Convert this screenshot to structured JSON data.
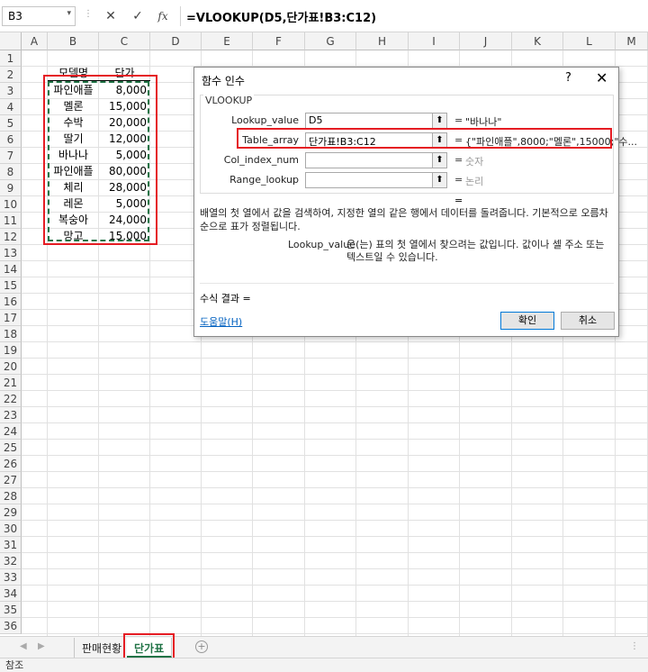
{
  "formula_bar": {
    "name_box": "B3",
    "cancel_icon": "✕",
    "enter_icon": "✓",
    "fx_label": "fx",
    "formula": "=VLOOKUP(D5,단가표!B3:C12)"
  },
  "columns": [
    "A",
    "B",
    "C",
    "D",
    "E",
    "F",
    "G",
    "H",
    "I",
    "J",
    "K",
    "L",
    "M"
  ],
  "rows": [
    "1",
    "2",
    "3",
    "4",
    "5",
    "6",
    "7",
    "8",
    "9",
    "10",
    "11",
    "12",
    "13",
    "14",
    "15",
    "16",
    "17",
    "18",
    "19",
    "20",
    "21",
    "22",
    "23",
    "24",
    "25",
    "26",
    "27",
    "28",
    "29",
    "30",
    "31",
    "32",
    "33",
    "34",
    "35",
    "36"
  ],
  "table": {
    "header_name": "모델명",
    "header_price": "단가",
    "items": [
      {
        "name": "파인애플",
        "price": "8,000"
      },
      {
        "name": "멜론",
        "price": "15,000"
      },
      {
        "name": "수박",
        "price": "20,000"
      },
      {
        "name": "딸기",
        "price": "12,000"
      },
      {
        "name": "바나나",
        "price": "5,000"
      },
      {
        "name": "파인애플",
        "price": "80,000"
      },
      {
        "name": "체리",
        "price": "28,000"
      },
      {
        "name": "레몬",
        "price": "5,000"
      },
      {
        "name": "복숭아",
        "price": "24,000"
      },
      {
        "name": "망고",
        "price": "15,000"
      }
    ]
  },
  "sheet_tabs": [
    {
      "label": "판매현황",
      "active": false
    },
    {
      "label": "단가표",
      "active": true
    }
  ],
  "status": "참조",
  "dialog": {
    "title": "함수 인수",
    "help_glyph": "?",
    "close_glyph": "✕",
    "function_name": "VLOOKUP",
    "args": [
      {
        "label": "Lookup_value",
        "value": "D5",
        "result": "\"바나나\"",
        "hint": false
      },
      {
        "label": "Table_array",
        "value": "단가표!B3:C12",
        "result": "{\"파인애플\",8000;\"멜론\",15000;\"수...",
        "hint": false
      },
      {
        "label": "Col_index_num",
        "value": "",
        "result": "숫자",
        "hint": true
      },
      {
        "label": "Range_lookup",
        "value": "",
        "result": "논리",
        "hint": true
      }
    ],
    "eq": "=",
    "description": "배열의 첫 열에서 값을 검색하여, 지정한 열의 같은 행에서 데이터를 돌려줍니다. 기본적으로 오름차순으로 표가 정렬됩니다.",
    "arg_name": "Lookup_value",
    "arg_description": "은(는) 표의 첫 열에서 찾으려는 값입니다. 값이나 셀 주소 또는 텍스트일 수 있습니다.",
    "result_label": "수식 결과 =",
    "help_link": "도움말(H)",
    "ok_label": "확인",
    "cancel_label": "취소"
  },
  "colors": {
    "accent_green": "#217346",
    "highlight_red": "#e51c23",
    "link_blue": "#0563c1"
  }
}
